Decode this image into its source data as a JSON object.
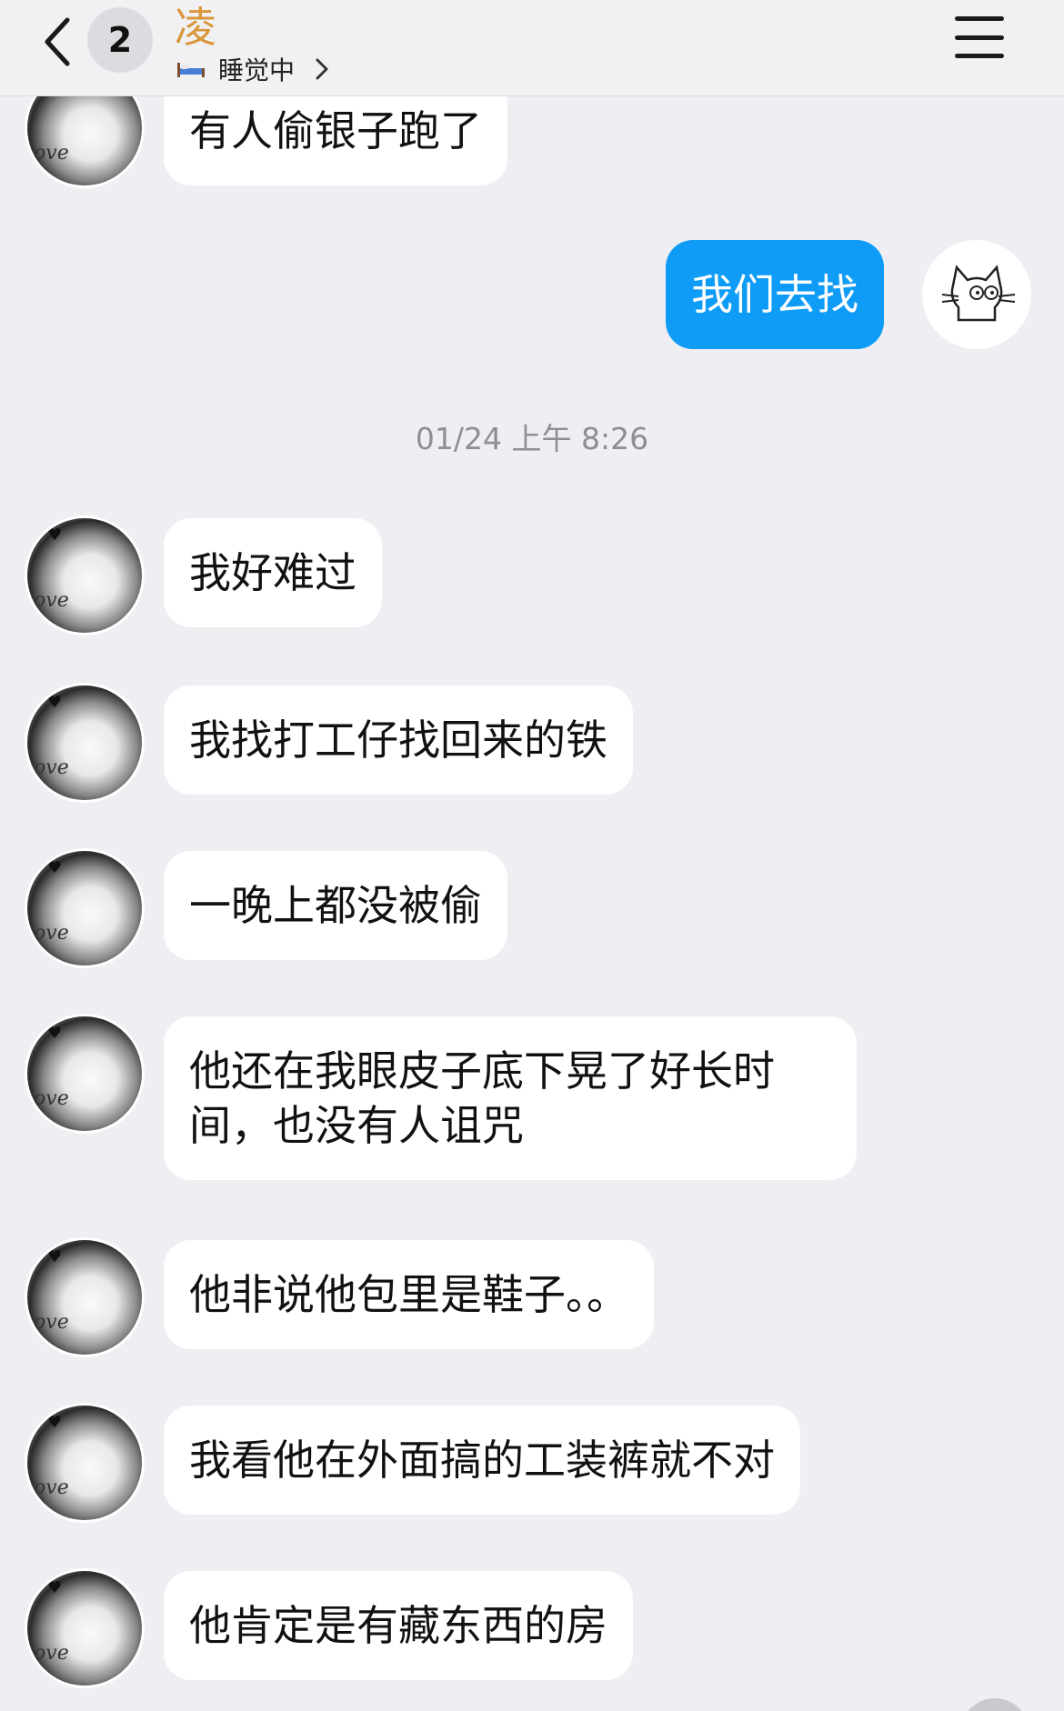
{
  "header": {
    "unread_count": "2",
    "contact_name": "凌",
    "status": "睡觉中"
  },
  "timestamp": "01/24 上午 8:26",
  "messages": [
    {
      "sender": "them",
      "text": "有人偷银子跑了"
    },
    {
      "sender": "me",
      "text": "我们去找"
    },
    {
      "sender": "them",
      "text": "我好难过"
    },
    {
      "sender": "them",
      "text": "我找打工仔找回来的铁"
    },
    {
      "sender": "them",
      "text": "一晚上都没被偷"
    },
    {
      "sender": "them",
      "text": "他还在我眼皮子底下晃了好长时间，也没有人诅咒"
    },
    {
      "sender": "them",
      "text": "他非说他包里是鞋子。。"
    },
    {
      "sender": "them",
      "text": "我看他在外面搞的工装裤就不对"
    },
    {
      "sender": "them",
      "text": "他肯定是有藏东西的房"
    }
  ],
  "avatar_text": "love",
  "colors": {
    "accent_bubble": "#0f9cf7",
    "name_color": "#d9963a",
    "background": "#eeeef3"
  },
  "icons": {
    "back": "chevron-left-icon",
    "status": "bed-icon",
    "status_arrow": "chevron-right-icon",
    "menu": "hamburger-menu-icon",
    "my_avatar": "cat-avatar"
  }
}
